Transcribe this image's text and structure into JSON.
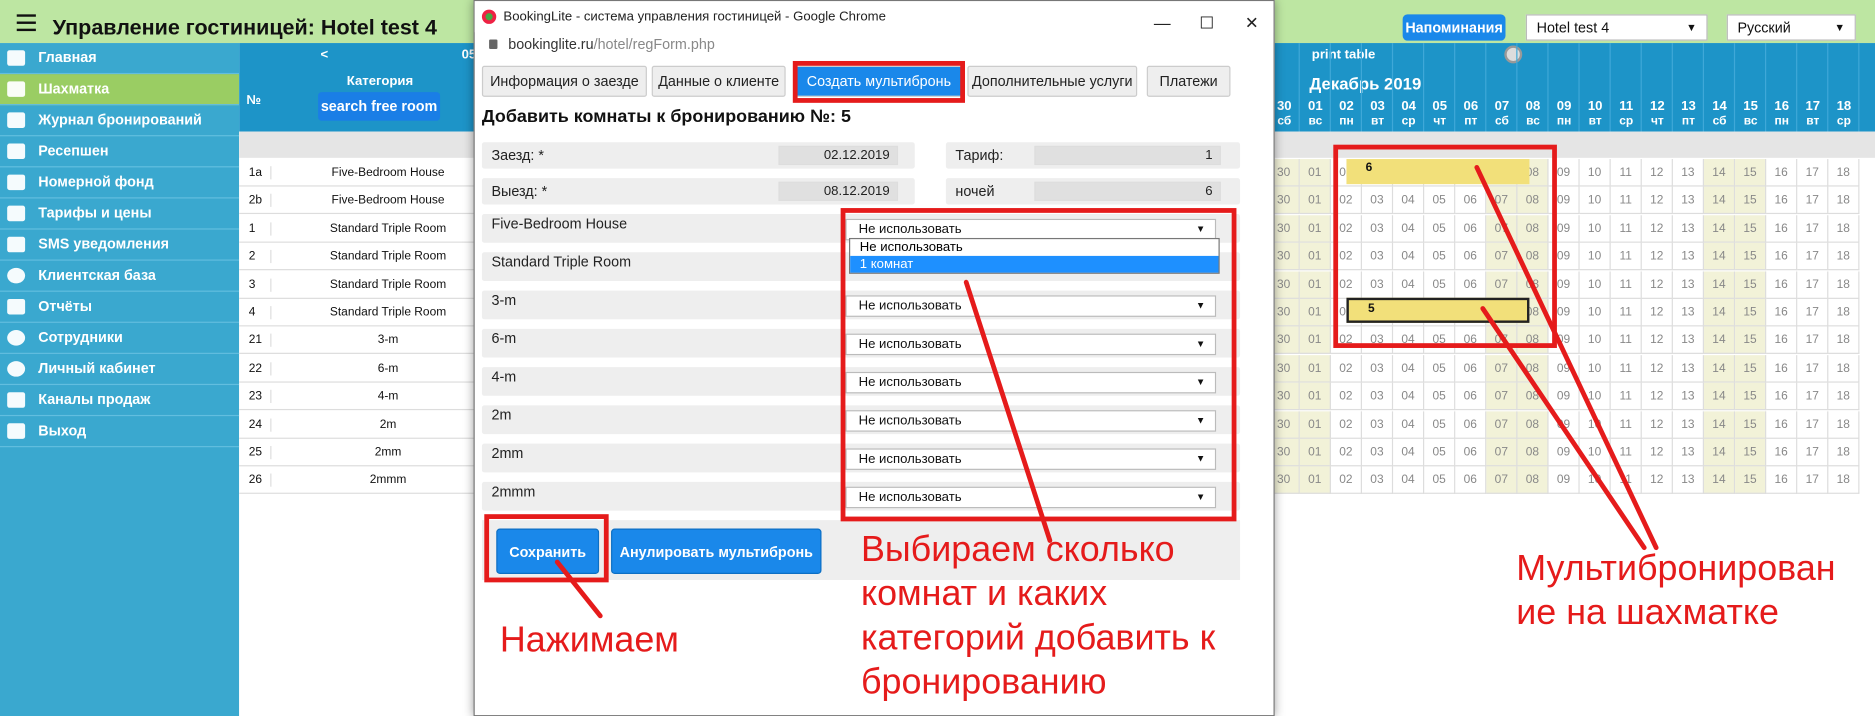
{
  "header": {
    "title": "Управление гостиницей: Hotel test 4",
    "remind": "Напоминания",
    "hotel": "Hotel test 4",
    "lang": "Русский"
  },
  "nav": [
    "Главная",
    "Шахматка",
    "Журнал бронирований",
    "Ресепшен",
    "Номерной фонд",
    "Тарифы и цены",
    "SMS уведомления",
    "Клиентская база",
    "Отчёты",
    "Сотрудники",
    "Личный кабинет",
    "Каналы продаж",
    "Выход"
  ],
  "grid": {
    "prev": "<",
    "partial": "05",
    "col_no": "№",
    "col_cat": "Категория",
    "search": "search free room",
    "print": "print table",
    "month": "Декабрь 2019",
    "days": [
      "30",
      "01",
      "02",
      "03",
      "04",
      "05",
      "06",
      "07",
      "08",
      "09",
      "10",
      "11",
      "12",
      "13",
      "14",
      "15",
      "16",
      "17",
      "18"
    ],
    "weekdays": [
      "сб",
      "вс",
      "пн",
      "вт",
      "ср",
      "чт",
      "пт",
      "сб",
      "вс",
      "пн",
      "вт",
      "ср",
      "чт",
      "пт",
      "сб",
      "вс",
      "пн",
      "вт",
      "ср"
    ],
    "rooms": [
      {
        "id": "1a",
        "cat": "Five-Bedroom House"
      },
      {
        "id": "2b",
        "cat": "Five-Bedroom House"
      },
      {
        "id": "1",
        "cat": "Standard Triple Room"
      },
      {
        "id": "2",
        "cat": "Standard Triple Room"
      },
      {
        "id": "3",
        "cat": "Standard Triple Room"
      },
      {
        "id": "4",
        "cat": "Standard Triple Room"
      },
      {
        "id": "21",
        "cat": "3-m"
      },
      {
        "id": "22",
        "cat": "6-m"
      },
      {
        "id": "23",
        "cat": "4-m"
      },
      {
        "id": "24",
        "cat": "2m"
      },
      {
        "id": "25",
        "cat": "2mm"
      },
      {
        "id": "26",
        "cat": "2mmm"
      }
    ],
    "booking_a": "6",
    "booking_b": "5"
  },
  "popup": {
    "window_title": "BookingLite - система управления гостиницей - Google Chrome",
    "url_host": "bookinglite.ru",
    "url_path": "/hotel/regForm.php",
    "tabs": [
      "Информация о заезде",
      "Данные о клиенте",
      "Создать мультибронь",
      "Дополнительные услуги",
      "Платежи"
    ],
    "heading": "Добавить комнаты к бронированию №: 5",
    "checkin_label": "Заезд: *",
    "checkin": "02.12.2019",
    "tariff_label": "Тариф:",
    "tariff": "1",
    "checkout_label": "Выезд: *",
    "checkout": "08.12.2019",
    "nights_label": "ночей",
    "nights": "6",
    "categories": [
      "Five-Bedroom House",
      "Standard Triple Room",
      "3-m",
      "6-m",
      "4-m",
      "2m",
      "2mm",
      "2mmm"
    ],
    "select_value": "Не использовать",
    "options": [
      "Не использовать",
      "1 комнат"
    ],
    "save": "Сохранить",
    "cancel": "Анулировать мультибронь"
  },
  "annotations": {
    "click": "Нажимаем",
    "choose": "Выбираем сколько комнат и каких категорий добавить к бронированию",
    "multi": "Мультибронирование на шахматке"
  },
  "colors": {
    "sidebar": "#3aa8cf",
    "active": "#9acd63",
    "header": "#1d94c8",
    "accent": "#1a88ea",
    "annotation": "#e51b1b"
  }
}
